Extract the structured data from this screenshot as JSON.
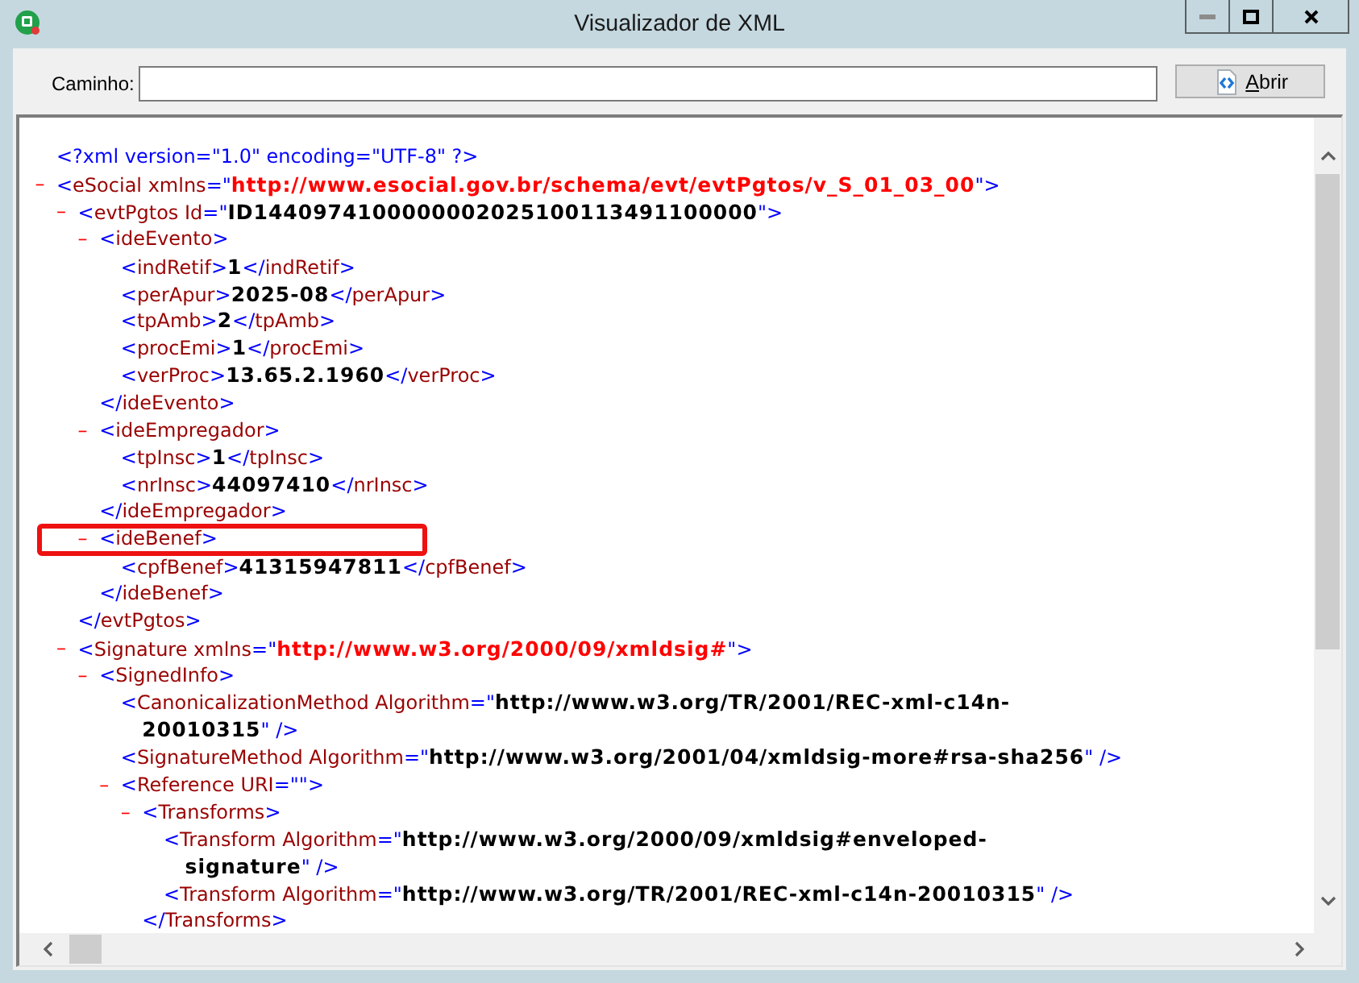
{
  "window": {
    "title": "Visualizador de XML",
    "controls": [
      {
        "kind": "minimize",
        "disabled": true
      },
      {
        "kind": "maximize",
        "disabled": false
      },
      {
        "kind": "close",
        "disabled": false
      }
    ]
  },
  "path_bar": {
    "label": "Caminho:"
  },
  "open_button": {
    "mnemonic": "A",
    "label_rest": "brir"
  },
  "xml_view": {
    "nodes": [
      {
        "kind": "declaration",
        "tokens": [
          {
            "kind": "mark",
            "text": "<?xml version=\"1.0\" encoding=\"UTF-8\" ?>"
          }
        ]
      },
      {
        "kind": "element",
        "toggle": "–",
        "expanded": true,
        "highlighted": false,
        "tokens": [
          {
            "kind": "mark",
            "text": "<"
          },
          {
            "kind": "name",
            "text": "eSocial"
          },
          {
            "kind": "name",
            "text": " xmlns"
          },
          {
            "kind": "mark",
            "text": "=\""
          },
          {
            "kind": "nsvalue",
            "text": "http://www.esocial.gov.br/schema/evt/evtPgtos/v_S_01_03_00"
          },
          {
            "kind": "mark",
            "text": "\">"
          }
        ],
        "children": [
          {
            "kind": "element",
            "toggle": "–",
            "expanded": true,
            "highlighted": false,
            "tokens": [
              {
                "kind": "mark",
                "text": "<"
              },
              {
                "kind": "name",
                "text": "evtPgtos"
              },
              {
                "kind": "name",
                "text": " Id"
              },
              {
                "kind": "mark",
                "text": "=\""
              },
              {
                "kind": "value",
                "text": "ID1440974100000002025100113491100000"
              },
              {
                "kind": "mark",
                "text": "\">"
              }
            ],
            "children": [
              {
                "kind": "element",
                "toggle": "–",
                "expanded": true,
                "highlighted": false,
                "tokens": [
                  {
                    "kind": "mark",
                    "text": "<"
                  },
                  {
                    "kind": "name",
                    "text": "ideEvento"
                  },
                  {
                    "kind": "mark",
                    "text": ">"
                  }
                ],
                "children": [
                  {
                    "kind": "leaf",
                    "tokens": [
                      {
                        "kind": "mark",
                        "text": "<"
                      },
                      {
                        "kind": "name",
                        "text": "indRetif"
                      },
                      {
                        "kind": "mark",
                        "text": ">"
                      },
                      {
                        "kind": "value",
                        "text": "1"
                      },
                      {
                        "kind": "mark",
                        "text": "</"
                      },
                      {
                        "kind": "name",
                        "text": "indRetif"
                      },
                      {
                        "kind": "mark",
                        "text": ">"
                      }
                    ]
                  },
                  {
                    "kind": "leaf",
                    "tokens": [
                      {
                        "kind": "mark",
                        "text": "<"
                      },
                      {
                        "kind": "name",
                        "text": "perApur"
                      },
                      {
                        "kind": "mark",
                        "text": ">"
                      },
                      {
                        "kind": "value",
                        "text": "2025-08"
                      },
                      {
                        "kind": "mark",
                        "text": "</"
                      },
                      {
                        "kind": "name",
                        "text": "perApur"
                      },
                      {
                        "kind": "mark",
                        "text": ">"
                      }
                    ]
                  },
                  {
                    "kind": "leaf",
                    "tokens": [
                      {
                        "kind": "mark",
                        "text": "<"
                      },
                      {
                        "kind": "name",
                        "text": "tpAmb"
                      },
                      {
                        "kind": "mark",
                        "text": ">"
                      },
                      {
                        "kind": "value",
                        "text": "2"
                      },
                      {
                        "kind": "mark",
                        "text": "</"
                      },
                      {
                        "kind": "name",
                        "text": "tpAmb"
                      },
                      {
                        "kind": "mark",
                        "text": ">"
                      }
                    ]
                  },
                  {
                    "kind": "leaf",
                    "tokens": [
                      {
                        "kind": "mark",
                        "text": "<"
                      },
                      {
                        "kind": "name",
                        "text": "procEmi"
                      },
                      {
                        "kind": "mark",
                        "text": ">"
                      },
                      {
                        "kind": "value",
                        "text": "1"
                      },
                      {
                        "kind": "mark",
                        "text": "</"
                      },
                      {
                        "kind": "name",
                        "text": "procEmi"
                      },
                      {
                        "kind": "mark",
                        "text": ">"
                      }
                    ]
                  },
                  {
                    "kind": "leaf",
                    "tokens": [
                      {
                        "kind": "mark",
                        "text": "<"
                      },
                      {
                        "kind": "name",
                        "text": "verProc"
                      },
                      {
                        "kind": "mark",
                        "text": ">"
                      },
                      {
                        "kind": "value",
                        "text": "13.65.2.1960"
                      },
                      {
                        "kind": "mark",
                        "text": "</"
                      },
                      {
                        "kind": "name",
                        "text": "verProc"
                      },
                      {
                        "kind": "mark",
                        "text": ">"
                      }
                    ]
                  }
                ],
                "end": [
                  {
                    "kind": "mark",
                    "text": "</"
                  },
                  {
                    "kind": "name",
                    "text": "ideEvento"
                  },
                  {
                    "kind": "mark",
                    "text": ">"
                  }
                ]
              },
              {
                "kind": "element",
                "toggle": "–",
                "expanded": true,
                "highlighted": false,
                "tokens": [
                  {
                    "kind": "mark",
                    "text": "<"
                  },
                  {
                    "kind": "name",
                    "text": "ideEmpregador"
                  },
                  {
                    "kind": "mark",
                    "text": ">"
                  }
                ],
                "children": [
                  {
                    "kind": "leaf",
                    "tokens": [
                      {
                        "kind": "mark",
                        "text": "<"
                      },
                      {
                        "kind": "name",
                        "text": "tpInsc"
                      },
                      {
                        "kind": "mark",
                        "text": ">"
                      },
                      {
                        "kind": "value",
                        "text": "1"
                      },
                      {
                        "kind": "mark",
                        "text": "</"
                      },
                      {
                        "kind": "name",
                        "text": "tpInsc"
                      },
                      {
                        "kind": "mark",
                        "text": ">"
                      }
                    ]
                  },
                  {
                    "kind": "leaf",
                    "tokens": [
                      {
                        "kind": "mark",
                        "text": "<"
                      },
                      {
                        "kind": "name",
                        "text": "nrInsc"
                      },
                      {
                        "kind": "mark",
                        "text": ">"
                      },
                      {
                        "kind": "value",
                        "text": "44097410"
                      },
                      {
                        "kind": "mark",
                        "text": "</"
                      },
                      {
                        "kind": "name",
                        "text": "nrInsc"
                      },
                      {
                        "kind": "mark",
                        "text": ">"
                      }
                    ]
                  }
                ],
                "end": [
                  {
                    "kind": "mark",
                    "text": "</"
                  },
                  {
                    "kind": "name",
                    "text": "ideEmpregador"
                  },
                  {
                    "kind": "mark",
                    "text": ">"
                  }
                ]
              },
              {
                "kind": "element",
                "toggle": "–",
                "expanded": true,
                "highlighted": true,
                "tokens": [
                  {
                    "kind": "mark",
                    "text": "<"
                  },
                  {
                    "kind": "name",
                    "text": "ideBenef"
                  },
                  {
                    "kind": "mark",
                    "text": ">"
                  }
                ],
                "children": [
                  {
                    "kind": "leaf",
                    "tokens": [
                      {
                        "kind": "mark",
                        "text": "<"
                      },
                      {
                        "kind": "name",
                        "text": "cpfBenef"
                      },
                      {
                        "kind": "mark",
                        "text": ">"
                      },
                      {
                        "kind": "value",
                        "text": "41315947811"
                      },
                      {
                        "kind": "mark",
                        "text": "</"
                      },
                      {
                        "kind": "name",
                        "text": "cpfBenef"
                      },
                      {
                        "kind": "mark",
                        "text": ">"
                      }
                    ]
                  }
                ],
                "end": [
                  {
                    "kind": "mark",
                    "text": "</"
                  },
                  {
                    "kind": "name",
                    "text": "ideBenef"
                  },
                  {
                    "kind": "mark",
                    "text": ">"
                  }
                ]
              }
            ],
            "end": [
              {
                "kind": "mark",
                "text": "</"
              },
              {
                "kind": "name",
                "text": "evtPgtos"
              },
              {
                "kind": "mark",
                "text": ">"
              }
            ]
          },
          {
            "kind": "element",
            "toggle": "–",
            "expanded": true,
            "highlighted": false,
            "tokens": [
              {
                "kind": "mark",
                "text": "<"
              },
              {
                "kind": "name",
                "text": "Signature"
              },
              {
                "kind": "name",
                "text": " xmlns"
              },
              {
                "kind": "mark",
                "text": "=\""
              },
              {
                "kind": "nsvalue",
                "text": "http://www.w3.org/2000/09/xmldsig#"
              },
              {
                "kind": "mark",
                "text": "\">"
              }
            ],
            "children": [
              {
                "kind": "element",
                "toggle": "–",
                "expanded": true,
                "highlighted": false,
                "tokens": [
                  {
                    "kind": "mark",
                    "text": "<"
                  },
                  {
                    "kind": "name",
                    "text": "SignedInfo"
                  },
                  {
                    "kind": "mark",
                    "text": ">"
                  }
                ],
                "children": [
                  {
                    "kind": "leaf",
                    "tokens": [
                      {
                        "kind": "mark",
                        "text": "<"
                      },
                      {
                        "kind": "name",
                        "text": "CanonicalizationMethod"
                      },
                      {
                        "kind": "name",
                        "text": " Algorithm"
                      },
                      {
                        "kind": "mark",
                        "text": "=\""
                      },
                      {
                        "kind": "value",
                        "text": "http://www.w3.org/TR/2001/REC-xml-c14n-"
                      }
                    ],
                    "continuation": [
                      {
                        "kind": "value",
                        "text": "20010315"
                      },
                      {
                        "kind": "mark",
                        "text": "\" />"
                      }
                    ]
                  },
                  {
                    "kind": "leaf",
                    "tokens": [
                      {
                        "kind": "mark",
                        "text": "<"
                      },
                      {
                        "kind": "name",
                        "text": "SignatureMethod"
                      },
                      {
                        "kind": "name",
                        "text": " Algorithm"
                      },
                      {
                        "kind": "mark",
                        "text": "=\""
                      },
                      {
                        "kind": "value",
                        "text": "http://www.w3.org/2001/04/xmldsig-more#rsa-sha256"
                      },
                      {
                        "kind": "mark",
                        "text": "\" />"
                      }
                    ]
                  },
                  {
                    "kind": "element",
                    "toggle": "–",
                    "expanded": true,
                    "highlighted": false,
                    "tokens": [
                      {
                        "kind": "mark",
                        "text": "<"
                      },
                      {
                        "kind": "name",
                        "text": "Reference"
                      },
                      {
                        "kind": "name",
                        "text": " URI"
                      },
                      {
                        "kind": "mark",
                        "text": "=\"\">"
                      }
                    ],
                    "children": [
                      {
                        "kind": "element",
                        "toggle": "–",
                        "expanded": true,
                        "highlighted": false,
                        "tokens": [
                          {
                            "kind": "mark",
                            "text": "<"
                          },
                          {
                            "kind": "name",
                            "text": "Transforms"
                          },
                          {
                            "kind": "mark",
                            "text": ">"
                          }
                        ],
                        "children": [
                          {
                            "kind": "leaf",
                            "tokens": [
                              {
                                "kind": "mark",
                                "text": "<"
                              },
                              {
                                "kind": "name",
                                "text": "Transform"
                              },
                              {
                                "kind": "name",
                                "text": " Algorithm"
                              },
                              {
                                "kind": "mark",
                                "text": "=\""
                              },
                              {
                                "kind": "value",
                                "text": "http://www.w3.org/2000/09/xmldsig#enveloped-"
                              }
                            ],
                            "continuation": [
                              {
                                "kind": "value",
                                "text": "signature"
                              },
                              {
                                "kind": "mark",
                                "text": "\" />"
                              }
                            ]
                          },
                          {
                            "kind": "leaf",
                            "tokens": [
                              {
                                "kind": "mark",
                                "text": "<"
                              },
                              {
                                "kind": "name",
                                "text": "Transform"
                              },
                              {
                                "kind": "name",
                                "text": " Algorithm"
                              },
                              {
                                "kind": "mark",
                                "text": "=\""
                              },
                              {
                                "kind": "value",
                                "text": "http://www.w3.org/TR/2001/REC-xml-c14n-20010315"
                              },
                              {
                                "kind": "mark",
                                "text": "\" />"
                              }
                            ]
                          }
                        ],
                        "end": [
                          {
                            "kind": "mark",
                            "text": "</"
                          },
                          {
                            "kind": "name",
                            "text": "Transforms"
                          },
                          {
                            "kind": "mark",
                            "text": ">"
                          }
                        ]
                      }
                    ]
                  }
                ]
              }
            ]
          }
        ]
      }
    ]
  }
}
